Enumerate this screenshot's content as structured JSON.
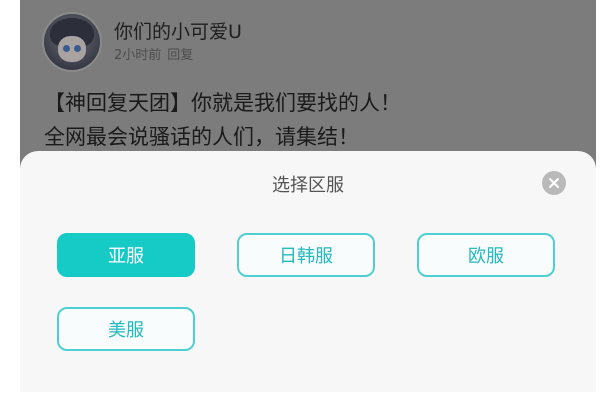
{
  "post": {
    "username": "你们的小可爱U",
    "time": "2小时前",
    "reply": "回复",
    "line1": "【神回复天团】你就是我们要找的人！",
    "line2": "全网最会说骚话的人们，请集结！"
  },
  "modal": {
    "title": "选择区服",
    "close_icon": "close-icon",
    "options": [
      {
        "label": "亚服",
        "selected": true
      },
      {
        "label": "日韩服",
        "selected": false
      },
      {
        "label": "欧服",
        "selected": false
      },
      {
        "label": "美服",
        "selected": false
      }
    ]
  },
  "colors": {
    "accent": "#16cbc6",
    "accent_border": "#4fcfd4",
    "accent_text": "#25b9c0",
    "overlay": "#7c7c7c",
    "sheet": "#f7f7f8"
  }
}
